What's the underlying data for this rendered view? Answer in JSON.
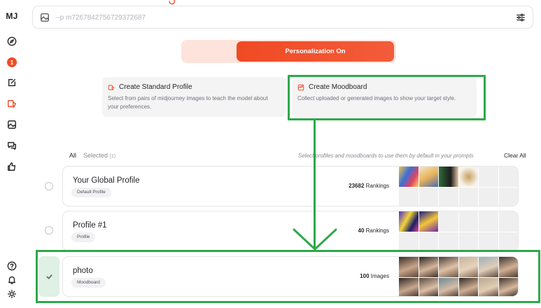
{
  "app": {
    "logo": "MJ"
  },
  "rail": {
    "notification_count": "1",
    "icons": [
      "explore-icon",
      "edit-icon",
      "personalize-icon",
      "image-icon",
      "chat-icon",
      "like-icon",
      "help-icon",
      "bell-icon",
      "sun-icon"
    ]
  },
  "search": {
    "placeholder": "--p m7267842756729372687"
  },
  "personalization": {
    "label": "Personalization On"
  },
  "create": {
    "standard": {
      "title": "Create Standard Profile",
      "desc": "Select from pairs of midjourney images to teach the model about your preferences."
    },
    "moodboard": {
      "title": "Create Moodboard",
      "desc": "Collect uploaded or generated images to show your target style."
    }
  },
  "filters": {
    "all": "All",
    "selected": "Selected",
    "selected_count": "(1)",
    "hint": "Select profiles and moodboards to use them by default in your prompts",
    "clear": "Clear All"
  },
  "profiles": [
    {
      "name": "Your Global Profile",
      "tag": "Default Profile",
      "count": "23682",
      "unit": "Rankings"
    },
    {
      "name": "Profile #1",
      "tag": "Profile",
      "count": "40",
      "unit": "Rankings"
    },
    {
      "name": "photo",
      "tag": "Moodboard",
      "count": "100",
      "unit": "Images"
    }
  ],
  "colors": {
    "accent": "#ef4d26",
    "annotation": "#2fa84a",
    "selected_bg": "#dff0e4"
  }
}
